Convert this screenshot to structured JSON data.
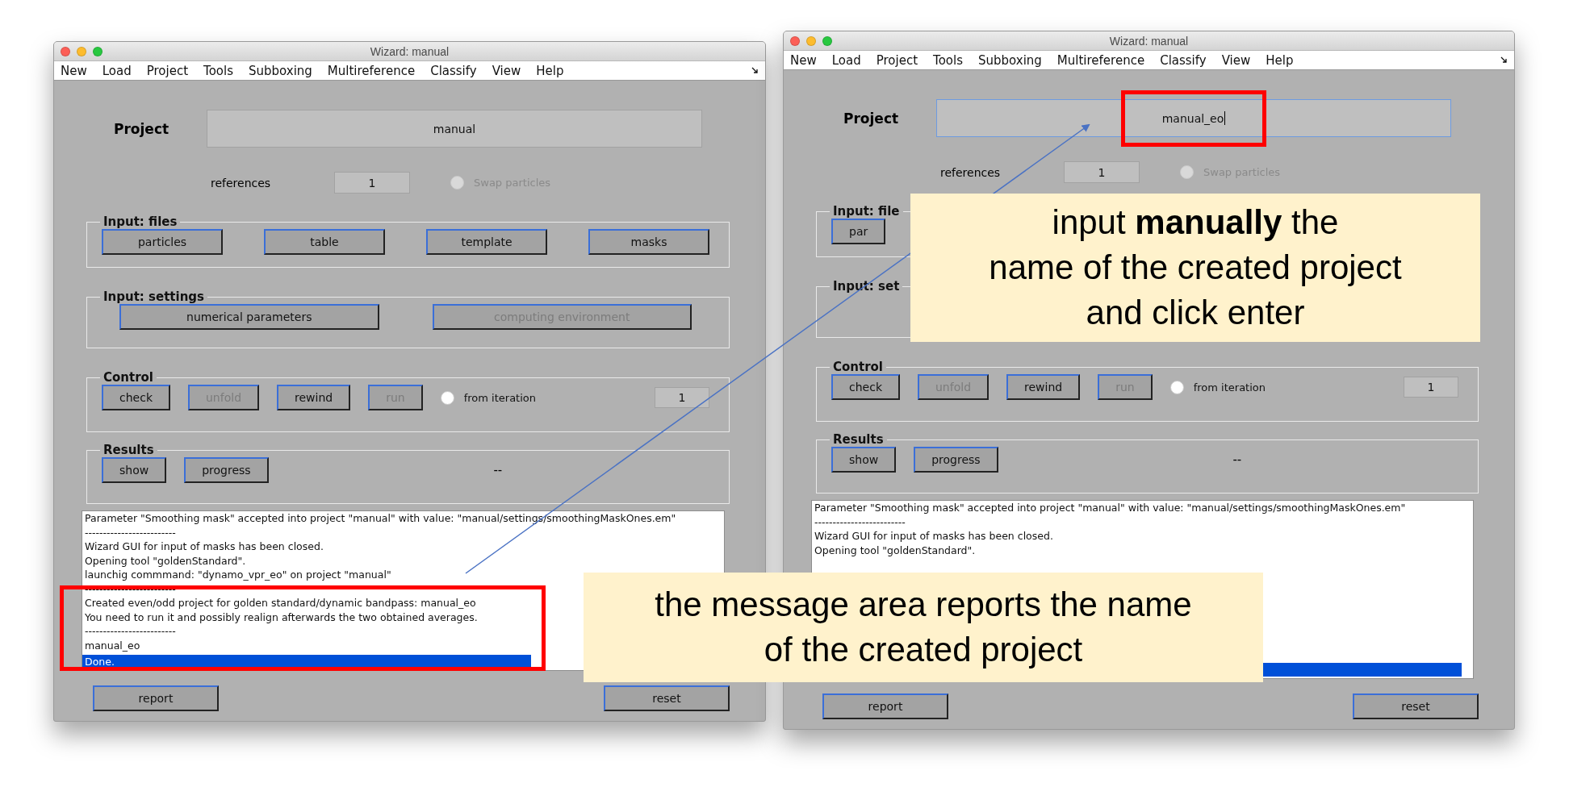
{
  "windows": [
    {
      "title": "Wizard: manual",
      "menu": [
        "New",
        "Load",
        "Project",
        "Tools",
        "Subboxing",
        "Multireference",
        "Classify",
        "View",
        "Help"
      ],
      "project": {
        "label": "Project",
        "value": "manual",
        "focused": false
      },
      "references": {
        "label": "references",
        "value": "1"
      },
      "swap": {
        "label": "Swap particles",
        "checked": false,
        "disabled": true
      },
      "groups": [
        {
          "title": "Input: files",
          "items": [
            {
              "kind": "button",
              "label": "particles",
              "disabled": false
            },
            {
              "kind": "button",
              "label": "table",
              "disabled": false
            },
            {
              "kind": "button",
              "label": "template",
              "disabled": false
            },
            {
              "kind": "button",
              "label": "masks",
              "disabled": false
            }
          ]
        },
        {
          "title": "Input: settings",
          "items": [
            {
              "kind": "button",
              "label": "numerical parameters",
              "disabled": false
            },
            {
              "kind": "button",
              "label": "computing environment",
              "disabled": true
            }
          ]
        },
        {
          "title": "Control",
          "items": [
            {
              "kind": "button",
              "label": "check",
              "disabled": false
            },
            {
              "kind": "button",
              "label": "unfold",
              "disabled": true
            },
            {
              "kind": "button",
              "label": "rewind",
              "disabled": false
            },
            {
              "kind": "button",
              "label": "run",
              "disabled": true
            },
            {
              "kind": "radio",
              "label": "from iteration",
              "checked": false
            },
            {
              "kind": "field",
              "value": "1"
            }
          ]
        },
        {
          "title": "Results",
          "items": [
            {
              "kind": "button",
              "label": "show",
              "disabled": false
            },
            {
              "kind": "button",
              "label": "progress",
              "disabled": false
            },
            {
              "kind": "text",
              "text": "--"
            }
          ]
        }
      ],
      "messages": [
        {
          "text": "Parameter \"Smoothing mask\" accepted into project \"manual\" with value: \"manual/settings/smoothingMaskOnes.em\"",
          "selected": false
        },
        {
          "text": "-------------------------",
          "selected": false
        },
        {
          "text": "Wizard GUI for input of masks has been closed.",
          "selected": false
        },
        {
          "text": "Opening tool \"goldenStandard\".",
          "selected": false
        },
        {
          "text": "launchig commmand: \"dynamo_vpr_eo\" on project \"manual\"",
          "selected": false
        },
        {
          "text": "-------------------------",
          "selected": false
        },
        {
          "text": "Created even/odd project for golden standard/dynamic bandpass: manual_eo",
          "selected": false
        },
        {
          "text": "You need to run it and possibly realign afterwards the two obtained averages.",
          "selected": false
        },
        {
          "text": "-------------------------",
          "selected": false
        },
        {
          "text": "manual_eo",
          "selected": false
        },
        {
          "text": "Done.",
          "selected": true
        }
      ],
      "buttons": [
        {
          "label": "report"
        },
        {
          "label": "reset"
        }
      ]
    },
    {
      "title": "Wizard: manual",
      "menu": [
        "New",
        "Load",
        "Project",
        "Tools",
        "Subboxing",
        "Multireference",
        "Classify",
        "View",
        "Help"
      ],
      "project": {
        "label": "Project",
        "value": "manual_eo",
        "focused": true
      },
      "references": {
        "label": "references",
        "value": "1"
      },
      "swap": {
        "label": "Swap particles",
        "checked": false,
        "disabled": true
      },
      "groups": [
        {
          "title": "Input: file",
          "items": [
            {
              "kind": "button",
              "label": "par",
              "disabled": false
            }
          ]
        },
        {
          "title": "Input: set"
        },
        {
          "title": "Control",
          "items": [
            {
              "kind": "button",
              "label": "check",
              "disabled": false
            },
            {
              "kind": "button",
              "label": "unfold",
              "disabled": true
            },
            {
              "kind": "button",
              "label": "rewind",
              "disabled": false
            },
            {
              "kind": "button",
              "label": "run",
              "disabled": true
            },
            {
              "kind": "radio",
              "label": "from iteration",
              "checked": false
            },
            {
              "kind": "field",
              "value": "1"
            }
          ]
        },
        {
          "title": "Results",
          "items": [
            {
              "kind": "button",
              "label": "show",
              "disabled": false
            },
            {
              "kind": "button",
              "label": "progress",
              "disabled": false
            },
            {
              "kind": "text",
              "text": "--"
            }
          ]
        }
      ],
      "messages": [
        {
          "text": "Parameter \"Smoothing mask\" accepted into project \"manual\" with value: \"manual/settings/smoothingMaskOnes.em\"",
          "selected": false
        },
        {
          "text": "-------------------------",
          "selected": false
        },
        {
          "text": "Wizard GUI for input of masks has been closed.",
          "selected": false
        },
        {
          "text": "Opening tool \"goldenStandard\".",
          "selected": false
        },
        {
          "selected": true
        }
      ],
      "buttons": [
        {
          "label": "report"
        },
        {
          "label": "reset"
        }
      ]
    }
  ],
  "callouts": [
    {
      "lines": [
        "input **manually** the",
        "name of the created project",
        "and click enter"
      ]
    },
    {
      "lines": [
        "the message area reports the name",
        "of the created project"
      ]
    }
  ]
}
